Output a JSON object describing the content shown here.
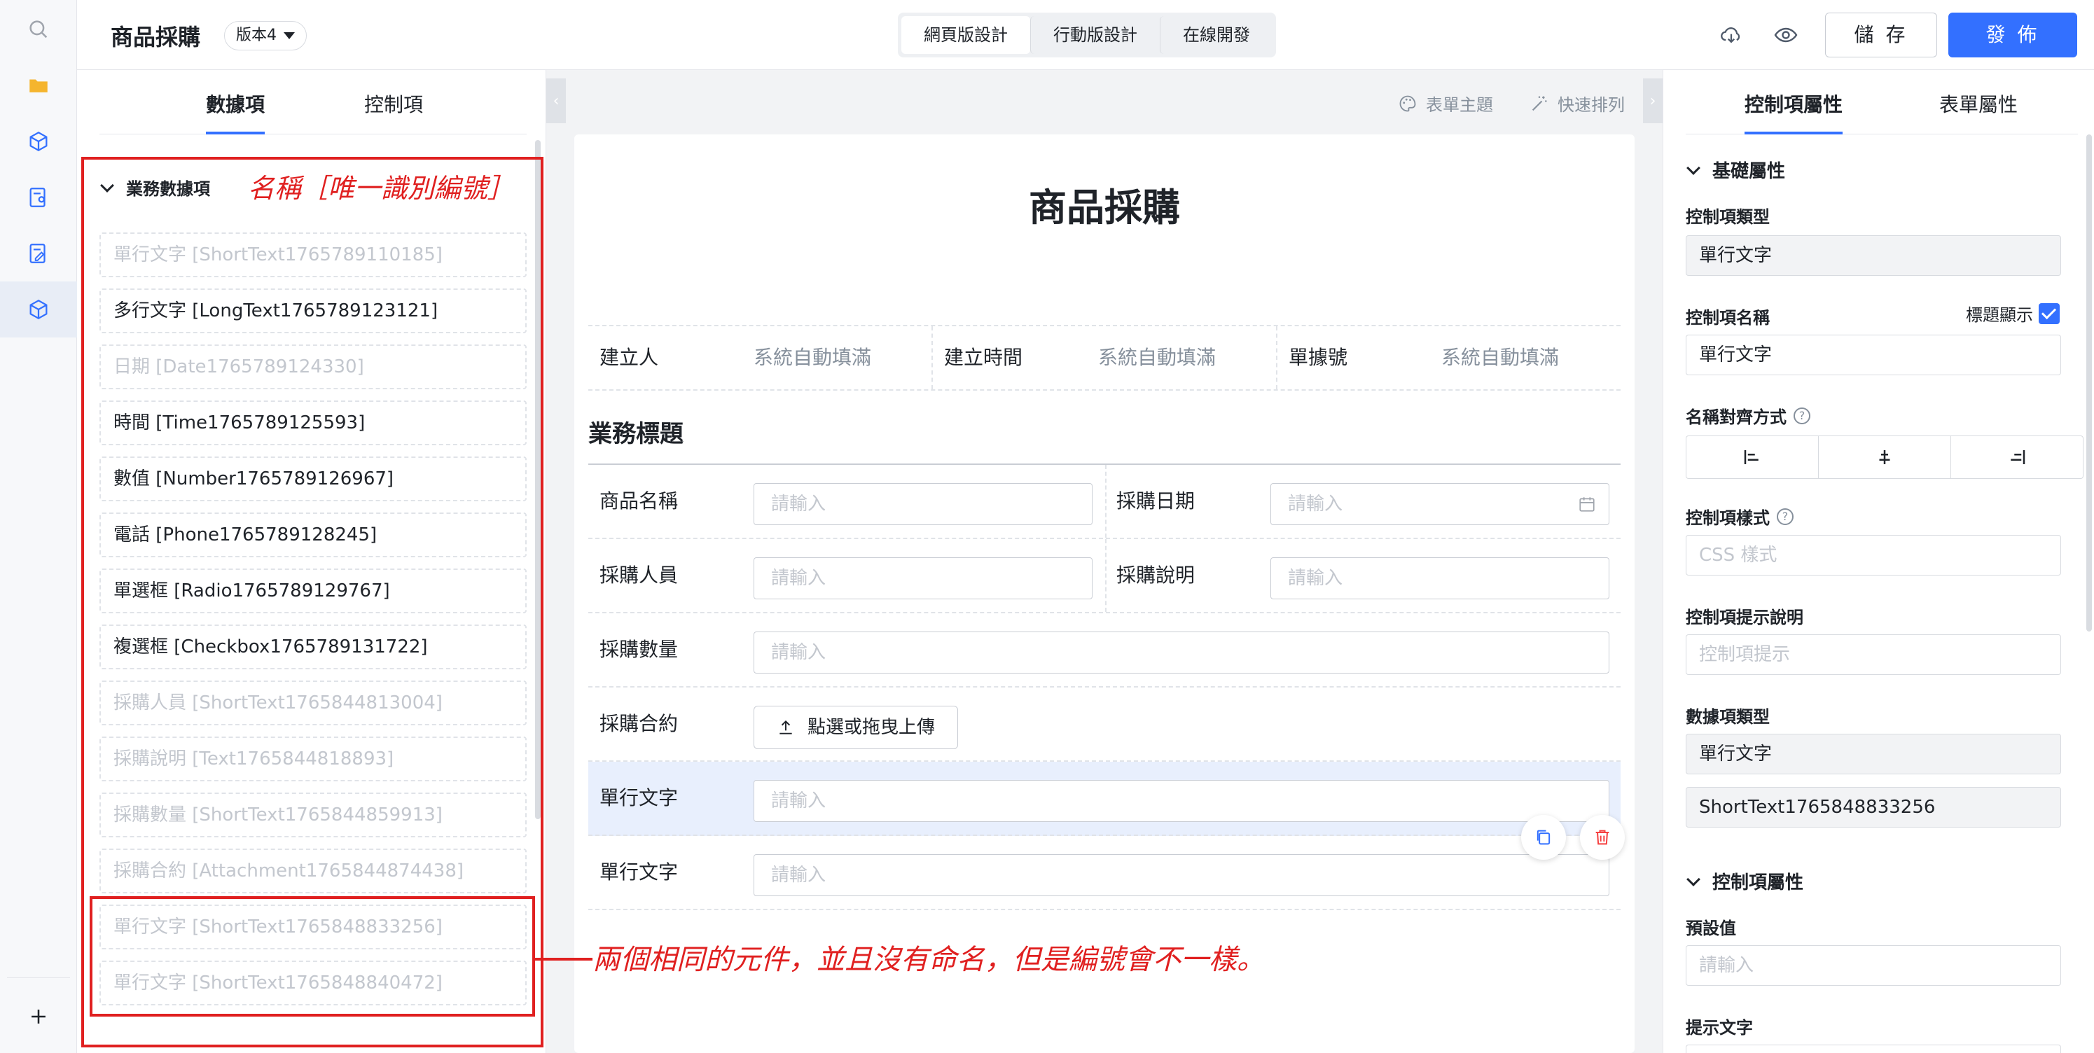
{
  "topbar": {
    "app_title": "商品採購",
    "version": "版本4",
    "mode_tabs": [
      "網頁版設計",
      "行動版設計",
      "在線開發"
    ],
    "save_label": "儲 存",
    "publish_label": "發 佈"
  },
  "left_panel": {
    "tabs": [
      "數據項",
      "控制項"
    ],
    "group_title": "業務數據項",
    "items": [
      "單行文字 [ShortText1765789110185]",
      "多行文字 [LongText1765789123121]",
      "日期 [Date1765789124330]",
      "時間 [Time1765789125593]",
      "數值 [Number1765789126967]",
      "電話 [Phone1765789128245]",
      "單選框 [Radio1765789129767]",
      "複選框 [Checkbox1765789131722]",
      "採購人員 [ShortText1765844813004]",
      "採購說明 [Text1765844818893]",
      "採購數量 [ShortText1765844859913]",
      "採購合約 [Attachment1765844874438]",
      "單行文字 [ShortText1765848833256]",
      "單行文字 [ShortText1765848840472]"
    ]
  },
  "annotations": {
    "name_note": "名稱［唯一識別編號］",
    "dup_note": "兩個相同的元件，並且沒有命名，但是編號會不一樣。"
  },
  "canvas": {
    "tools": [
      "表單主題",
      "快速排列"
    ],
    "form_title": "商品採購",
    "meta": [
      {
        "label": "建立人",
        "value": "系統自動填滿"
      },
      {
        "label": "建立時間",
        "value": "系統自動填滿"
      },
      {
        "label": "單據號",
        "value": "系統自動填滿"
      }
    ],
    "section_title": "業務標題",
    "placeholder": "請輸入",
    "fields": {
      "product_name": "商品名稱",
      "purchase_date": "採購日期",
      "purchaser": "採購人員",
      "purchase_desc": "採購說明",
      "quantity": "採購數量",
      "contract": "採購合約",
      "upload": "點選或拖曳上傳",
      "single_a": "單行文字",
      "single_b": "單行文字"
    }
  },
  "right_panel": {
    "tabs": [
      "控制項屬性",
      "表單屬性"
    ],
    "basic_group": "基礎屬性",
    "control_type_label": "控制項類型",
    "control_type_value": "單行文字",
    "control_name_label": "控制項名稱",
    "show_title_label": "標題顯示",
    "control_name_value": "單行文字",
    "align_label": "名稱對齊方式",
    "style_label": "控制項樣式",
    "style_placeholder": "CSS 樣式",
    "hint_label": "控制項提示說明",
    "hint_placeholder": "控制項提示",
    "data_type_label": "數據項類型",
    "data_type_value": "單行文字",
    "data_id_value": "ShortText1765848833256",
    "control_group": "控制項屬性",
    "default_label": "預設值",
    "default_placeholder": "請輸入",
    "tip_label": "提示文字"
  },
  "colors": {
    "accent": "#3370ff",
    "annotation": "#e02020",
    "selected_row": "#e8effd"
  }
}
